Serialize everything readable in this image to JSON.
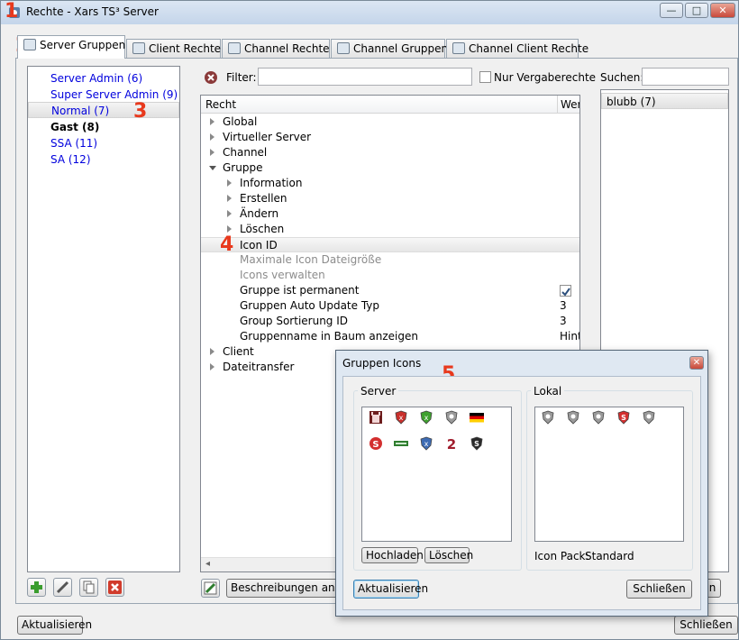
{
  "window": {
    "title": "Rechte - Xars TS³ Server",
    "controls": {
      "minimize": "—",
      "maximize": "□",
      "close": "✕"
    }
  },
  "markers": [
    "1",
    "2",
    "3",
    "4",
    "5"
  ],
  "tabs": [
    {
      "label": "Server Gruppen",
      "active": true
    },
    {
      "label": "Client Rechte",
      "active": false
    },
    {
      "label": "Channel Rechte",
      "active": false
    },
    {
      "label": "Channel Gruppen",
      "active": false
    },
    {
      "label": "Channel Client Rechte",
      "active": false
    }
  ],
  "groups": [
    {
      "label": "Server Admin (6)",
      "style": "link"
    },
    {
      "label": "Super Server Admin (9)",
      "style": "link"
    },
    {
      "label": "Normal (7)",
      "style": "selected"
    },
    {
      "label": "Gast (8)",
      "style": "bold"
    },
    {
      "label": "SSA (11)",
      "style": "link"
    },
    {
      "label": "SA (12)",
      "style": "link"
    }
  ],
  "filter": {
    "label": "Filter:",
    "value": "",
    "nur_label": "Nur Vergaberechte"
  },
  "tree": {
    "col_recht": "Recht",
    "col_wert": "Wer",
    "rows": [
      {
        "label": "Global",
        "level": 0,
        "expander": "closed",
        "value": ""
      },
      {
        "label": "Virtueller Server",
        "level": 0,
        "expander": "closed",
        "value": ""
      },
      {
        "label": "Channel",
        "level": 0,
        "expander": "closed",
        "value": ""
      },
      {
        "label": "Gruppe",
        "level": 0,
        "expander": "open",
        "value": ""
      },
      {
        "label": "Information",
        "level": 1,
        "expander": "closed",
        "value": ""
      },
      {
        "label": "Erstellen",
        "level": 1,
        "expander": "closed",
        "value": ""
      },
      {
        "label": "Ändern",
        "level": 1,
        "expander": "closed",
        "value": ""
      },
      {
        "label": "Löschen",
        "level": 1,
        "expander": "closed",
        "value": ""
      },
      {
        "label": "Icon ID",
        "level": 1,
        "expander": "none",
        "value": "",
        "selected": true
      },
      {
        "label": "Maximale Icon Dateigröße",
        "level": 1,
        "expander": "none",
        "value": "",
        "gray": true
      },
      {
        "label": "Icons verwalten",
        "level": 1,
        "expander": "none",
        "value": "",
        "gray": true
      },
      {
        "label": "Gruppe  ist permanent",
        "level": 1,
        "expander": "none",
        "value": "",
        "checkbox": true
      },
      {
        "label": "Gruppen Auto Update Typ",
        "level": 1,
        "expander": "none",
        "value": "3"
      },
      {
        "label": "Group Sortierung ID",
        "level": 1,
        "expander": "none",
        "value": "3"
      },
      {
        "label": "Gruppenname in Baum anzeigen",
        "level": 1,
        "expander": "none",
        "value": "Hint"
      },
      {
        "label": "Client",
        "level": 0,
        "expander": "closed",
        "value": ""
      },
      {
        "label": "Dateitransfer",
        "level": 0,
        "expander": "closed",
        "value": ""
      }
    ]
  },
  "search": {
    "label": "Suchen:",
    "value": "",
    "results": [
      "blubb (7)"
    ]
  },
  "buttons": {
    "beschreibungen": "Beschreibungen anzeige",
    "aktualisieren": "Aktualisieren",
    "schliessen": "Schließen",
    "hidden_right": "n"
  },
  "dialog": {
    "title": "Gruppen Icons",
    "server_legend": "Server",
    "lokal_legend": "Lokal",
    "hochladen": "Hochladen",
    "loeschen": "Löschen",
    "icon_pack_label": "Icon Pack:",
    "icon_pack_value": "Standard",
    "aktualisieren": "Aktualisieren",
    "schliessen": "Schließen",
    "server_icons": [
      "castle-icon",
      "red-shield-icon",
      "green-shield-icon",
      "gray-shield-icon",
      "german-flag-icon",
      "red-round-s-icon",
      "green-tag-icon",
      "blue-shield-icon",
      "red-two-icon",
      "black-s-shield-icon"
    ],
    "local_icons": [
      "gray-shield-icon",
      "gray-shield-icon",
      "gray-shield-icon",
      "red-s-shield-icon",
      "gray-shield-icon"
    ]
  },
  "colors": {
    "link": "#0000dd",
    "marker": "#e8391d"
  }
}
